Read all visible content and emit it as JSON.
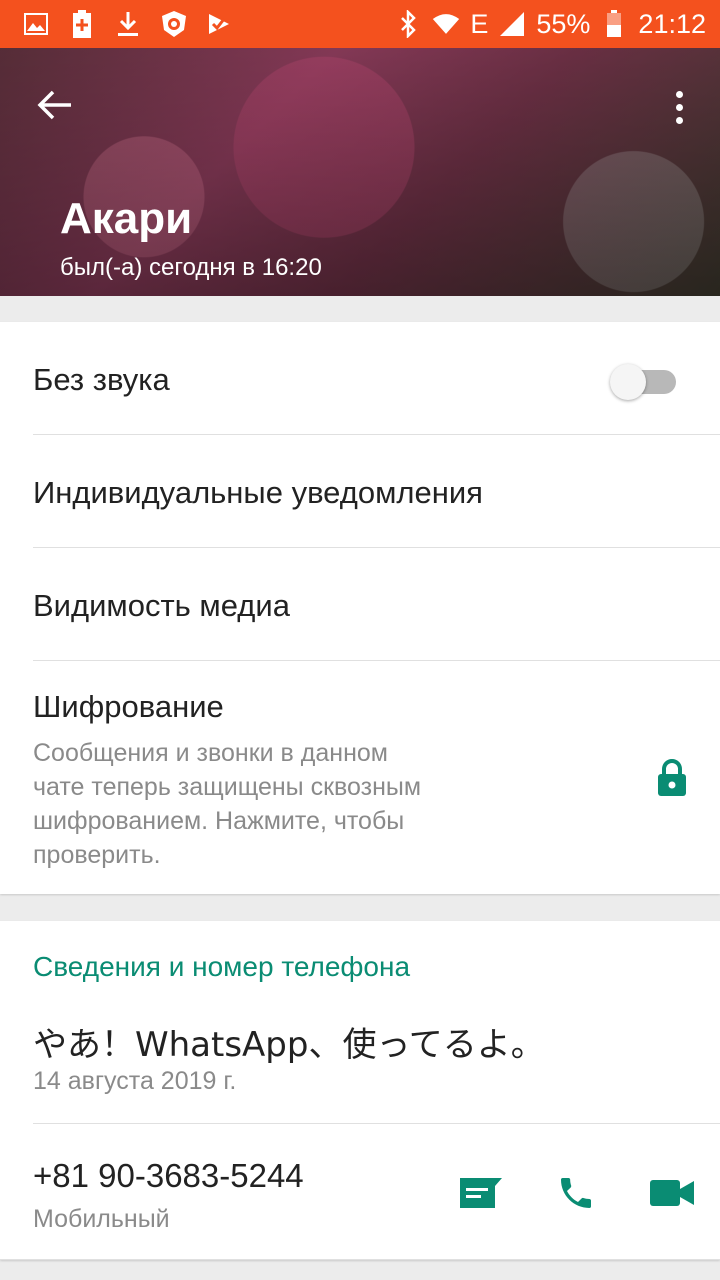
{
  "status_bar": {
    "battery_percent": "55%",
    "time": "21:12",
    "network_label": "E",
    "left_icons": [
      "gallery-icon",
      "battery-saver-icon",
      "download-icon",
      "lion-app-icon",
      "check-app-icon"
    ],
    "right_icons": [
      "bluetooth-icon",
      "wifi-icon",
      "signal-icon",
      "battery-icon"
    ],
    "color": "#f4511e"
  },
  "header": {
    "name": "Акари",
    "last_seen": "был(-а) сегодня в 16:20",
    "back_icon": "back-arrow-icon",
    "menu_icon": "more-vert-icon"
  },
  "settings": {
    "mute_label": "Без звука",
    "mute_on": false,
    "custom_notifications_label": "Индивидуальные уведомления",
    "media_visibility_label": "Видимость медиа",
    "encryption_label": "Шифрование",
    "encryption_desc_lines": [
      "Сообщения и звонки в данном",
      "чате теперь защищены сквозным",
      "шифрованием. Нажмите, чтобы",
      "проверить."
    ],
    "lock_icon": "lock-icon"
  },
  "info": {
    "section_title": "Сведения и номер телефона",
    "about": "やあ！WhatsApp、使ってるよ。",
    "about_date": "14 августа 2019 г.",
    "phone": "+81 90-3683-5244",
    "phone_type": "Мобильный",
    "actions": [
      "message-icon",
      "call-icon",
      "video-call-icon"
    ],
    "accent_color": "#0a8c73"
  }
}
